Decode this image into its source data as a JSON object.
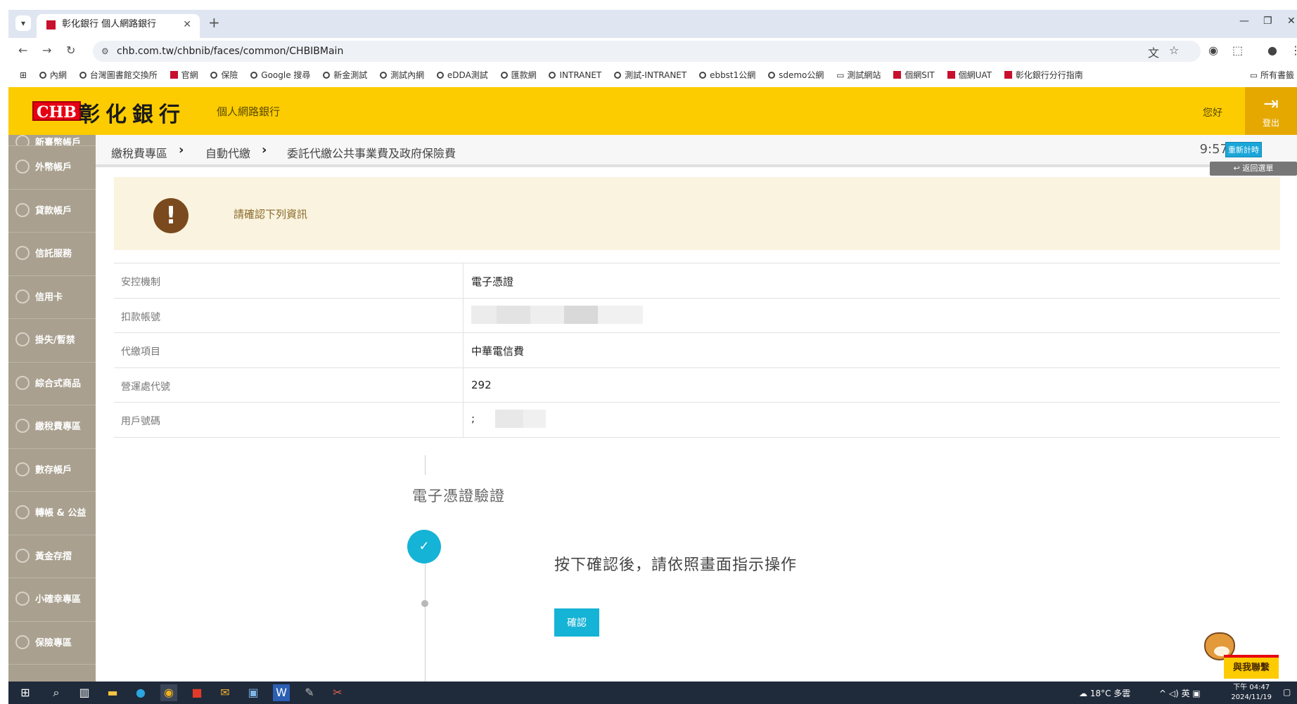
{
  "browser": {
    "tab_title": "彰化銀行 個人網路銀行",
    "url": "chb.com.tw/chbnib/faces/common/CHBIBMain",
    "bookmarks": [
      "內網",
      "台灣圖書館交換所",
      "官網",
      "保險",
      "Google 搜尋",
      "新金測試",
      "測試內網",
      "eDDA測試",
      "匯款網",
      "INTRANET",
      "測試-INTRANET",
      "ebbst1公網",
      "sdemo公網",
      "測試網站",
      "個網SIT",
      "個網UAT",
      "彰化銀行分行指南"
    ],
    "bookmarks_right": "所有書籤"
  },
  "header": {
    "logo_mark": "CHB",
    "logo_text": "彰化銀行",
    "subtitle": "個人網路銀行",
    "greeting": "您好",
    "logout_label": "登出"
  },
  "sidebar": {
    "items": [
      "新臺幣帳戶",
      "外幣帳戶",
      "貸款帳戶",
      "信託服務",
      "信用卡",
      "掛失/暫禁",
      "綜合式商品",
      "繳稅費專區",
      "數存帳戶",
      "轉帳 & 公益",
      "黃金存摺",
      "小確幸專區",
      "保險專區"
    ]
  },
  "breadcrumb": {
    "items": [
      "繳稅費專區",
      "自動代繳",
      "委託代繳公共事業費及政府保險費"
    ],
    "time": "9:57",
    "refresh_label": "重新計時",
    "back_label": "返回選單"
  },
  "notice": {
    "text": "請確認下列資訊"
  },
  "info": {
    "rows": [
      {
        "label": "安控機制",
        "value": "電子憑證"
      },
      {
        "label": "扣款帳號",
        "value": ""
      },
      {
        "label": "代繳項目",
        "value": "中華電信費"
      },
      {
        "label": "營運處代號",
        "value": "292"
      },
      {
        "label": "用戶號碼",
        "value": ";"
      }
    ]
  },
  "step": {
    "title": "電子憑證驗證",
    "instruction": "按下確認後，請依照畫面指示操作",
    "confirm_label": "確認"
  },
  "mascot": {
    "label": "與我聯繫"
  },
  "taskbar": {
    "weather": "18°C 多雲",
    "ime": "英",
    "time": "下午 04:47",
    "date": "2024/11/19"
  }
}
